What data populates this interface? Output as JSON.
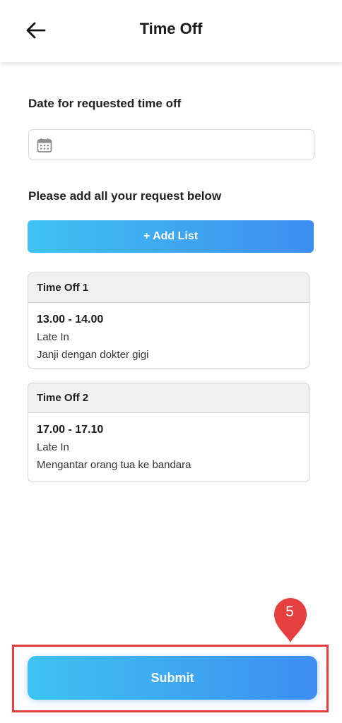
{
  "header": {
    "title": "Time Off",
    "back_icon": "arrow-left-icon"
  },
  "form": {
    "date_label": "Date for requested time off",
    "date_value": "",
    "date_icon": "calendar-icon",
    "requests_label": "Please add all your request below",
    "add_list_label": "+ Add List"
  },
  "requests": [
    {
      "title": "Time Off 1",
      "time": "13.00 - 14.00",
      "type": "Late In",
      "note": "Janji dengan dokter gigi"
    },
    {
      "title": "Time Off 2",
      "time": "17.00 - 17.10",
      "type": "Late In",
      "note": "Mengantar orang tua ke bandara"
    }
  ],
  "footer": {
    "submit_label": "Submit"
  },
  "annotation": {
    "step_number": "5",
    "color": "#e5403f"
  },
  "colors": {
    "accent_start": "#3ec2f1",
    "accent_end": "#3d8ef0"
  }
}
